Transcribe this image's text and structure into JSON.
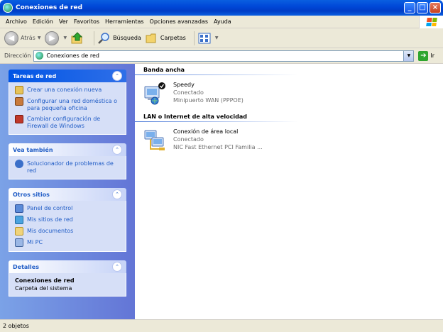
{
  "window": {
    "title": "Conexiones de red"
  },
  "menu": [
    "Archivo",
    "Edición",
    "Ver",
    "Favoritos",
    "Herramientas",
    "Opciones avanzadas",
    "Ayuda"
  ],
  "toolbar": {
    "back_label": "Atrás",
    "search_label": "Búsqueda",
    "folders_label": "Carpetas"
  },
  "address": {
    "label": "Dirección",
    "value": "Conexiones de red",
    "go_label": "Ir"
  },
  "panels": {
    "tasks": {
      "title": "Tareas de red",
      "items": [
        "Crear una conexión nueva",
        "Configurar una red doméstica o para pequeña oficina",
        "Cambiar configuración de Firewall de Windows"
      ]
    },
    "see_also": {
      "title": "Vea también",
      "items": [
        "Solucionador de problemas de red"
      ]
    },
    "other_places": {
      "title": "Otros sitios",
      "items": [
        "Panel de control",
        "Mis sitios de red",
        "Mis documentos",
        "Mi PC"
      ]
    },
    "details": {
      "title": "Detalles",
      "name": "Conexiones de red",
      "sub": "Carpeta del sistema"
    }
  },
  "groups": [
    {
      "title": "Banda ancha",
      "items": [
        {
          "name": "Speedy",
          "status": "Conectado",
          "device": "Minipuerto WAN (PPPOE)"
        }
      ]
    },
    {
      "title": "LAN o Internet de alta velocidad",
      "items": [
        {
          "name": "Conexión de área local",
          "status": "Conectado",
          "device": "NIC Fast Ethernet PCI Familia ..."
        }
      ]
    }
  ],
  "status": {
    "text": "2 objetos"
  },
  "colors": {
    "titlebar": "#0048d8",
    "sidebar": "#7ba2e7",
    "link": "#215dc6"
  }
}
